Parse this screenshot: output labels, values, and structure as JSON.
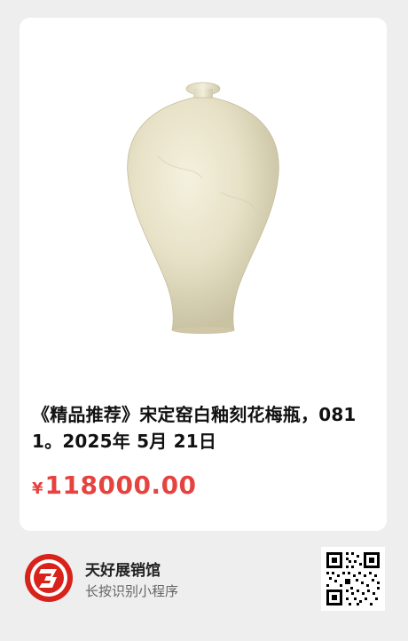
{
  "product": {
    "title": "《精品推荐》宋定窑白釉刻花梅瓶，0811。2025年 5月 21日",
    "currency_symbol": "¥",
    "price": "118000.00"
  },
  "mini_program": {
    "name": "天好展销馆",
    "hint": "长按识别小程序"
  },
  "colors": {
    "price": "#e64340",
    "logo_red": "#d8231c"
  },
  "icons": {
    "logo": "tianhao-logo-icon",
    "qr": "qr-code-icon"
  }
}
